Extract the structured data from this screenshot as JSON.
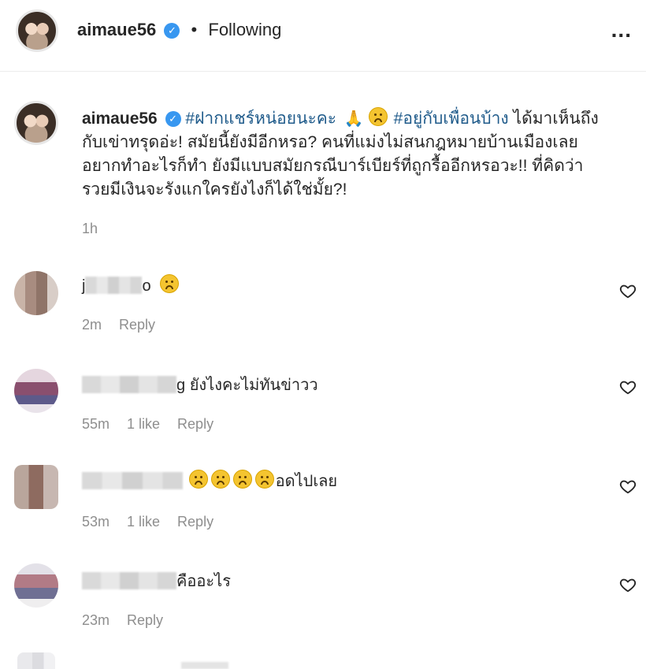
{
  "header": {
    "username": "aimaue56",
    "separator": "•",
    "follow_status": "Following",
    "more": "..."
  },
  "caption": {
    "username": "aimaue56",
    "hashtag1": "#ฝากแชร์หน่อยนะคะ",
    "hashtag2": "#อยู่กับเพื่อนบ้าง",
    "text_line1_tail": "ได้มาเห็นถึง",
    "line2": "กับเข่าทรุดอ่ะ! สมัยนี้ยังมีอีกหรอ? คนที่แม่งไม่สนกฎหมายบ้านเมืองเลย",
    "line3": "อยากทำอะไรก็ทำ ยังมีแบบสมัยกรณีบาร์เบียร์ที่ถูกรื้ออีกหรอวะ!! ที่คิดว่า",
    "line4": "รวยมีเงินจะรังแกใครยังไงก็ได้ใช่มั้ย?!",
    "time": "1h"
  },
  "comments": [
    {
      "name_visible": "j",
      "name_tail": "o",
      "text": "",
      "time": "2m",
      "likes": "",
      "reply": "Reply"
    },
    {
      "name_visible": "",
      "name_tail": "g",
      "text": "ยังไงคะไม่ทันข่าวว",
      "time": "55m",
      "likes": "1 like",
      "reply": "Reply"
    },
    {
      "name_visible": "",
      "name_tail": "",
      "text": "อดไปเลย",
      "time": "53m",
      "likes": "1 like",
      "reply": "Reply"
    },
    {
      "name_visible": "",
      "name_tail": "",
      "text": "คืออะไร",
      "time": "23m",
      "likes": "",
      "reply": "Reply"
    }
  ],
  "icons": {
    "verified": "verified-badge-icon",
    "heart": "heart-outline-icon",
    "more": "more-options-icon"
  }
}
